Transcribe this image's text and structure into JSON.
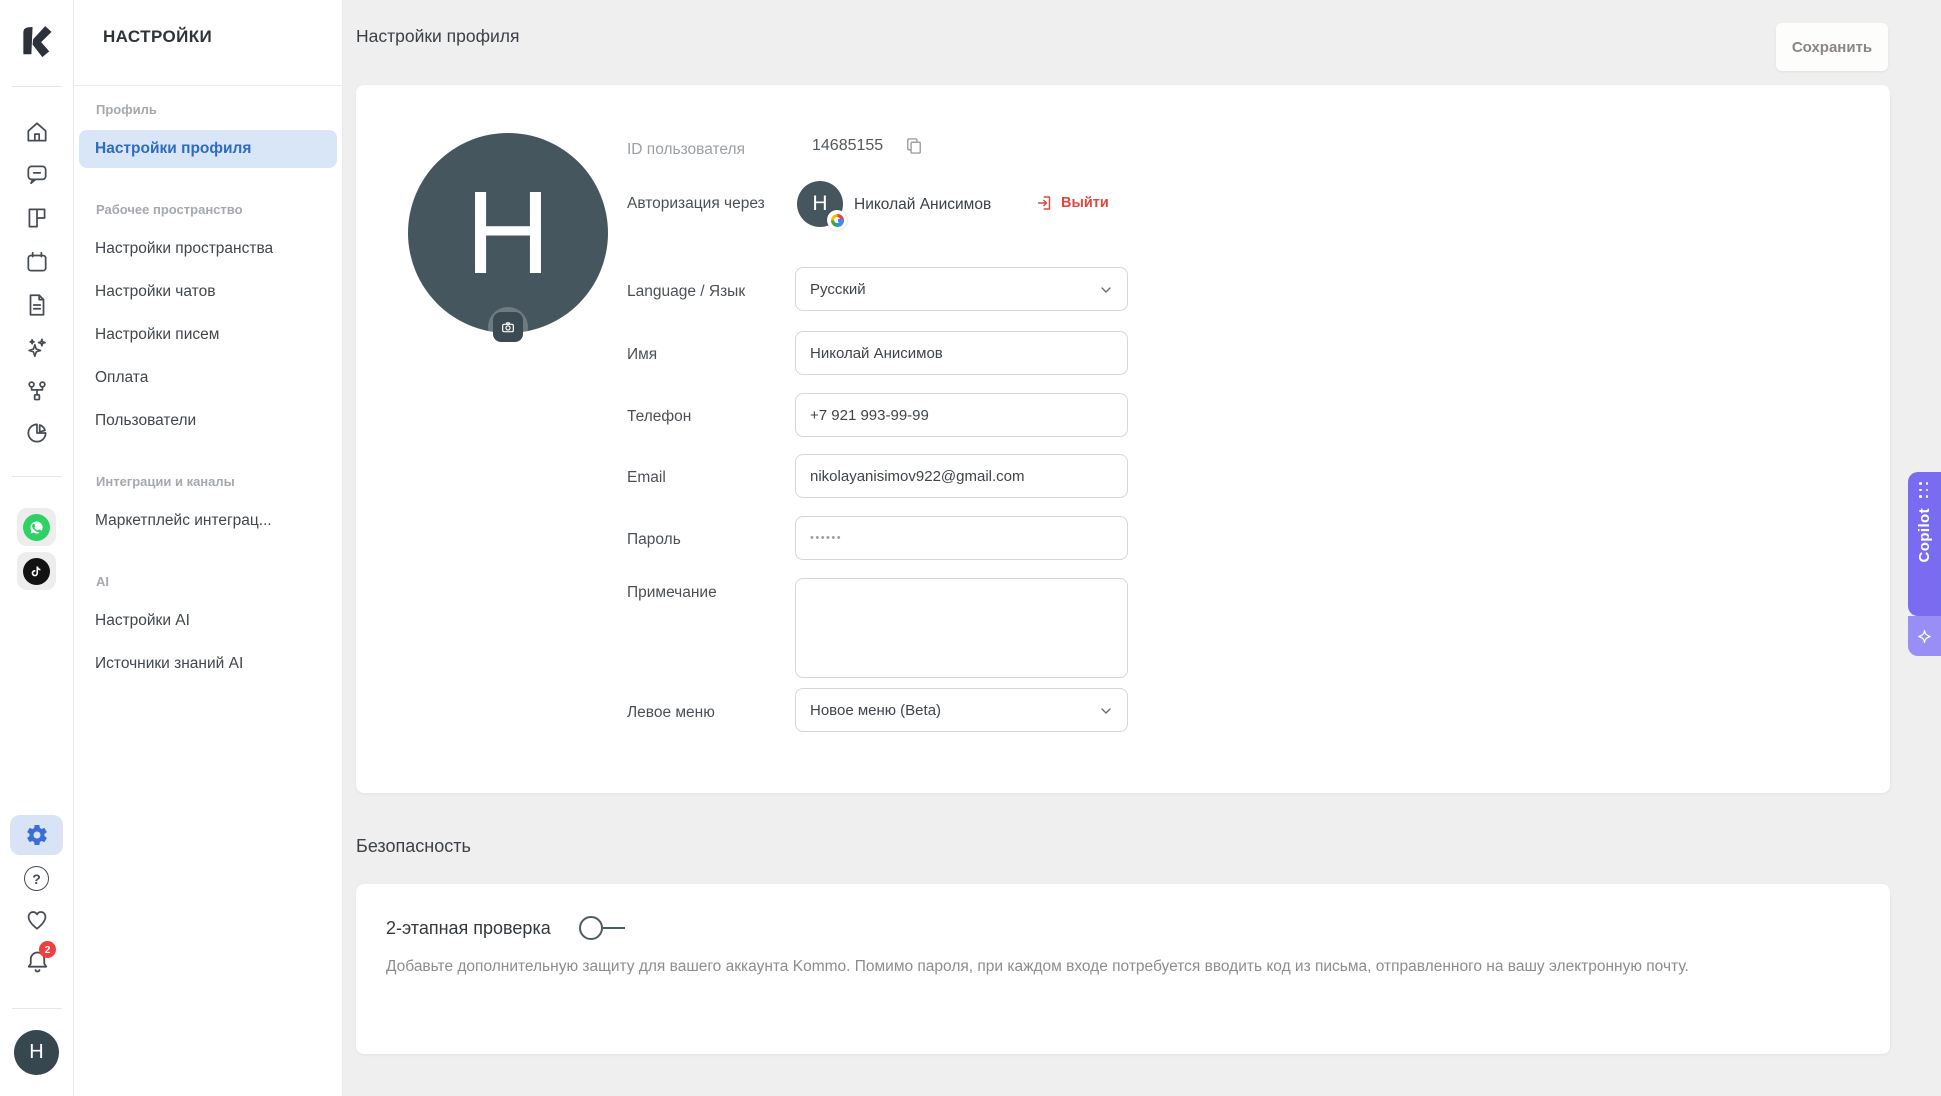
{
  "colors": {
    "accent_blue": "#2d6cbf",
    "active_bg": "#d9e6f8",
    "gear_blue": "#3a6fd8",
    "danger_red": "#e0483e",
    "badge_red": "#f03f3f",
    "whatsapp_green": "#2ed163",
    "tiktok_black": "#121212",
    "avatar_slate": "#46565e",
    "copilot_purple": "#7a6cf0",
    "main_bg": "#efefef"
  },
  "icon_rail": {
    "notifications_badge": "2",
    "user_initial": "Н"
  },
  "sidebar": {
    "title": "НАСТРОЙКИ",
    "sections": [
      {
        "label": "Профиль",
        "items": [
          {
            "label": "Настройки профиля",
            "active": true
          }
        ]
      },
      {
        "label": "Рабочее пространство",
        "items": [
          {
            "label": "Настройки пространства"
          },
          {
            "label": "Настройки чатов"
          },
          {
            "label": "Настройки писем"
          },
          {
            "label": "Оплата"
          },
          {
            "label": "Пользователи"
          }
        ]
      },
      {
        "label": "Интеграции и каналы",
        "items": [
          {
            "label": "Маркетплейс интеграц..."
          }
        ]
      },
      {
        "label": "AI",
        "items": [
          {
            "label": "Настройки AI"
          },
          {
            "label": "Источники знаний AI"
          }
        ]
      }
    ]
  },
  "header": {
    "title": "Настройки профиля",
    "save_label": "Сохранить"
  },
  "profile_card": {
    "avatar_initial": "Н",
    "id": {
      "label": "ID пользователя",
      "value": "14685155"
    },
    "auth": {
      "label": "Авторизация через",
      "avatar_initial": "Н",
      "name": "Николай Анисимов",
      "logout_label": "Выйти"
    },
    "language": {
      "label": "Language / Язык",
      "value": "Русский"
    },
    "name": {
      "label": "Имя",
      "value": "Николай Анисимов"
    },
    "phone": {
      "label": "Телефон",
      "value": "+7 921 993-99-99"
    },
    "email": {
      "label": "Email",
      "value": "nikolayanisimov922@gmail.com"
    },
    "password": {
      "label": "Пароль",
      "value": "••••••"
    },
    "note": {
      "label": "Примечание",
      "value": ""
    },
    "left_menu": {
      "label": "Левое меню",
      "value": "Новое меню (Beta)"
    }
  },
  "security": {
    "heading": "Безопасность",
    "tfa_title": "2-этапная проверка",
    "tfa_description": "Добавьте дополнительную защиту для вашего аккаунта Kommo. Помимо пароля, при каждом входе потребуется вводить код из письма, отправленного на вашу электронную почту."
  },
  "copilot": {
    "label": "Copilot"
  }
}
